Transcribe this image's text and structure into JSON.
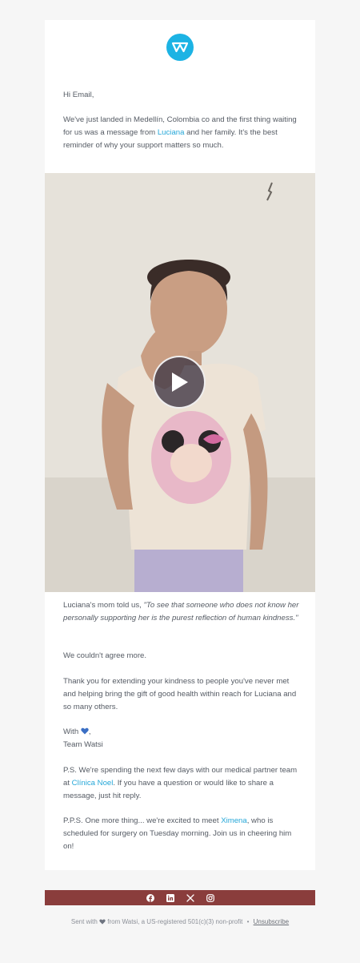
{
  "greeting": "Hi Email,",
  "intro": {
    "before_link": "We've just landed in Medellín, Colombia co and the first thing waiting for us was a message from ",
    "link": "Luciana",
    "after_link": " and her family. It's the best reminder of why your support matters so much."
  },
  "quote": {
    "lead": "Luciana's mom told us, ",
    "text": "\"To see that someone who does not know her personally supporting her is the purest reflection of human kindness.\""
  },
  "agree": "We couldn't agree more.",
  "thanks": "Thank you for extending your kindness to people you've never met and helping bring the gift of good health within reach for Luciana and so many others.",
  "signoff": {
    "with": "With",
    "after_heart": ",",
    "team": "Team Watsi"
  },
  "ps": {
    "before_link": "P.S. We're spending the next few days with our medical partner team at ",
    "link": "Clínica Noel",
    "after_link": ". If you have a question or would like to share a message, just hit reply."
  },
  "pps": {
    "before_link": "P.P.S. One more thing... we're excited to meet ",
    "link": "Ximena",
    "after_link": ", who is scheduled for surgery on Tuesday morning. Join us in cheering him on!"
  },
  "social_icons": [
    "facebook-icon",
    "linkedin-icon",
    "x-icon",
    "instagram-icon"
  ],
  "footer": {
    "sent_with": "Sent with",
    "from_text": "from Watsi, a US-registered 501(c)(3) non-profit",
    "separator": "•",
    "unsubscribe": "Unsubscribe"
  },
  "colors": {
    "brand": "#1cb3e4",
    "link": "#25a7d8",
    "footer_bar": "#8a3d3c",
    "heart": "#3b6fc4",
    "background": "#f6f6f6"
  }
}
